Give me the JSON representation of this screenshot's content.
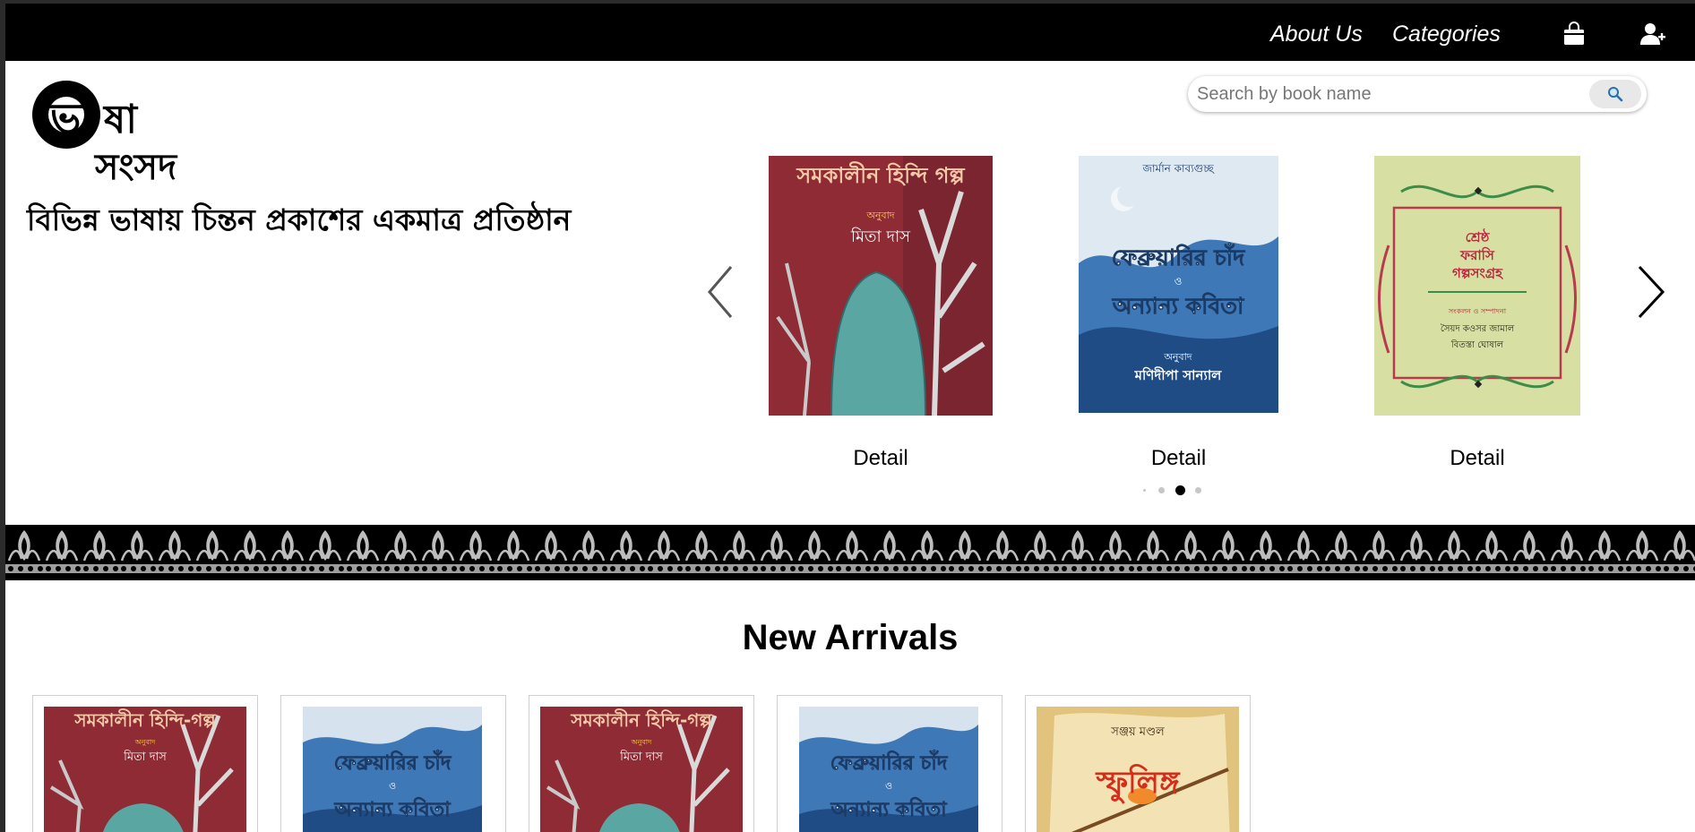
{
  "nav": {
    "links": [
      "About Us",
      "Categories"
    ],
    "icons": [
      "shopping-bag-icon",
      "user-plus-icon"
    ]
  },
  "brand": {
    "logo_text_1": "ভা",
    "logo_text_2": "ষা",
    "logo_text_3": "সংসদ",
    "tagline": "বিভিন্ন ভাষায় চিন্তন প্রকাশের একমাত্র প্রতিষ্ঠান"
  },
  "search": {
    "placeholder": "Search by book name",
    "button_icon": "search-icon"
  },
  "carousel": {
    "items": [
      {
        "title": "সমকালীন হিন্দি গল্প",
        "subtitle": "অনুবাদ",
        "author": "মিতা দাস",
        "detail": "Detail"
      },
      {
        "series": "জার্মান কাব্যগুচ্ছ",
        "title_1": "ফেব্রুয়ারির চাঁদ",
        "title_mid": "ও",
        "title_2": "অন্যান্য কবিতা",
        "subtitle": "অনুবাদ",
        "author": "মণিদীপা সান্যাল",
        "detail": "Detail"
      },
      {
        "title_1": "শ্রেষ্ঠ",
        "title_2": "ফরাসি",
        "title_3": "গল্পসংগ্রহ",
        "subtitle": "সংকলন ও সম্পাদনা",
        "author_1": "সৈয়দ কওসর জামাল",
        "author_2": "বিতস্তা ঘোষাল",
        "detail": "Detail"
      }
    ],
    "dots": 4,
    "active_dot": 3
  },
  "new_arrivals": {
    "title": "New Arrivals",
    "books": [
      {
        "title": "সমকালীন হিন্দি-গল্প",
        "subtitle": "অনুবাদ",
        "author": "মিতা দাস"
      },
      {
        "title_1": "ফেব্রুয়ারির চাঁদ",
        "title_mid": "ও",
        "title_2": "অন্যান্য কবিতা"
      },
      {
        "title": "সমকালীন হিন্দি-গল্প",
        "subtitle": "অনুবাদ",
        "author": "মিতা দাস"
      },
      {
        "title_1": "ফেব্রুয়ারির চাঁদ",
        "title_mid": "ও",
        "title_2": "অন্যান্য কবিতা"
      },
      {
        "author": "সঞ্জয় মণ্ডল",
        "title": "স্ফুলিঙ্গ"
      }
    ]
  },
  "colors": {
    "nav_bg": "#000000",
    "page_bg": "#ffffff",
    "frame": "#2b2b2b"
  }
}
